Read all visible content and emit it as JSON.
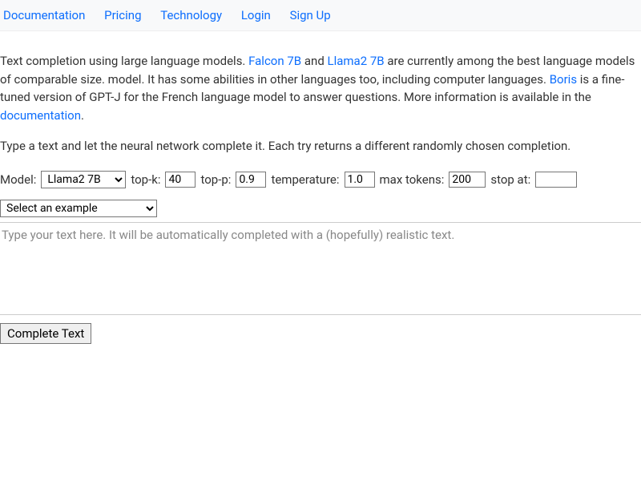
{
  "nav": {
    "documentation": "Documentation",
    "pricing": "Pricing",
    "technology": "Technology",
    "login": "Login",
    "signup": "Sign Up"
  },
  "desc": {
    "part1": "Text completion using large language models. ",
    "link_falcon": "Falcon 7B",
    "part2": " and ",
    "link_llama": "Llama2 7B",
    "part3": " are currently among the best language models of comparable size. ",
    "part4": "model. It has some abilities in other languages too, including computer languages. ",
    "link_boris": "Boris",
    "part5": " is a fine-tuned version of GPT-J for the French language model to answer questions. More information is available in the ",
    "link_doc": "documentation",
    "part6": "."
  },
  "instructions": "Type a text and let the neural network complete it. Each try returns a different randomly chosen completion.",
  "controls": {
    "model_label": "Model:",
    "model_value": "Llama2 7B",
    "topk_label": "top-k:",
    "topk_value": "40",
    "topp_label": "top-p:",
    "topp_value": "0.9",
    "temp_label": "temperature:",
    "temp_value": "1.0",
    "maxtok_label": "max tokens:",
    "maxtok_value": "200",
    "stopat_label": "stop at:",
    "stopat_value": ""
  },
  "example_select": "Select an example",
  "textarea_placeholder": "Type your text here. It will be automatically completed with a (hopefully) realistic text.",
  "complete_button": "Complete Text"
}
